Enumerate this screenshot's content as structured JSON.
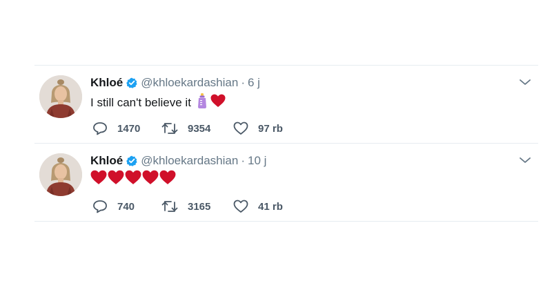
{
  "tweets": [
    {
      "name": "Khloé",
      "handle": "@khloekardashian",
      "separator": "·",
      "time": "6 j",
      "text": "I still can't believe it",
      "emojis": [
        "baby-bottle-emoji",
        "red-heart-emoji"
      ],
      "replies": "1470",
      "retweets": "9354",
      "likes": "97 rb"
    },
    {
      "name": "Khloé",
      "handle": "@khloekardashian",
      "separator": "·",
      "time": "10 j",
      "text": "",
      "emojis": [
        "red-heart-emoji",
        "red-heart-emoji",
        "red-heart-emoji",
        "red-heart-emoji",
        "red-heart-emoji"
      ],
      "replies": "740",
      "retweets": "3165",
      "likes": "41 rb"
    }
  ],
  "icons": {
    "verified": "verified-badge-icon",
    "caret": "chevron-down-icon",
    "reply": "reply-icon",
    "retweet": "retweet-icon",
    "like": "heart-outline-icon"
  },
  "colors": {
    "verified_blue": "#1da1f2",
    "heart_red": "#d0102a",
    "muted_text": "#657786",
    "divider": "#e6ecf0"
  }
}
